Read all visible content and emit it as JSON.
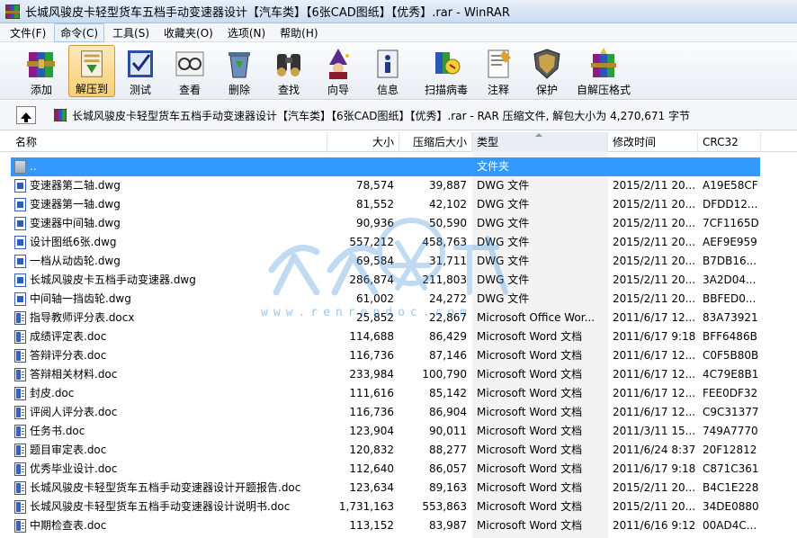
{
  "window": {
    "title": "长城风骏皮卡轻型货车五档手动变速器设计【汽车类】【6张CAD图纸】【优秀】.rar - WinRAR"
  },
  "menu": [
    {
      "label": "文件(F)"
    },
    {
      "label": "命令(C)"
    },
    {
      "label": "工具(S)"
    },
    {
      "label": "收藏夹(O)"
    },
    {
      "label": "选项(N)"
    },
    {
      "label": "帮助(H)"
    }
  ],
  "toolbar": [
    {
      "label": "添加",
      "icon": "add-books-icon"
    },
    {
      "label": "解压到",
      "icon": "extract-to-icon"
    },
    {
      "label": "测试",
      "icon": "test-check-icon"
    },
    {
      "label": "查看",
      "icon": "view-glasses-icon"
    },
    {
      "label": "删除",
      "icon": "delete-recycle-icon"
    },
    {
      "label": "查找",
      "icon": "find-binoculars-icon"
    },
    {
      "label": "向导",
      "icon": "wizard-icon"
    },
    {
      "label": "信息",
      "icon": "info-icon"
    },
    {
      "label": "扫描病毒",
      "icon": "scan-virus-icon"
    },
    {
      "label": "注释",
      "icon": "comment-icon"
    },
    {
      "label": "保护",
      "icon": "protect-shield-icon"
    },
    {
      "label": "自解压格式",
      "icon": "sfx-icon"
    }
  ],
  "pathbar": {
    "text": "长城风骏皮卡轻型货车五档手动变速器设计【汽车类】【6张CAD图纸】【优秀】.rar - RAR 压缩文件, 解包大小为 4,270,671 字节"
  },
  "columns": {
    "name": "名称",
    "size": "大小",
    "packed": "压缩后大小",
    "type": "类型",
    "modified": "修改时间",
    "crc": "CRC32"
  },
  "watermark": {
    "text": "人人文库",
    "url": "www.renrendoc.com"
  },
  "files": [
    {
      "name": "..",
      "size": "",
      "packed": "",
      "type": "文件夹",
      "modified": "",
      "crc": "",
      "kind": "folder",
      "selected": true
    },
    {
      "name": "变速器第二轴.dwg",
      "size": "78,574",
      "packed": "39,887",
      "type": "DWG 文件",
      "modified": "2015/2/11 20...",
      "crc": "A19E58CF",
      "kind": "dwg"
    },
    {
      "name": "变速器第一轴.dwg",
      "size": "81,552",
      "packed": "42,102",
      "type": "DWG 文件",
      "modified": "2015/2/11 20...",
      "crc": "DFDD12...",
      "kind": "dwg"
    },
    {
      "name": "变速器中间轴.dwg",
      "size": "90,936",
      "packed": "50,590",
      "type": "DWG 文件",
      "modified": "2015/2/11 20...",
      "crc": "7CF1165D",
      "kind": "dwg"
    },
    {
      "name": "设计图纸6张.dwg",
      "size": "557,212",
      "packed": "458,763",
      "type": "DWG 文件",
      "modified": "2015/2/11 20...",
      "crc": "AEF9E959",
      "kind": "dwg"
    },
    {
      "name": "一档从动齿轮.dwg",
      "size": "69,584",
      "packed": "31,711",
      "type": "DWG 文件",
      "modified": "2015/2/11 20...",
      "crc": "B7DB16...",
      "kind": "dwg"
    },
    {
      "name": "长城风骏皮卡五档手动变速器.dwg",
      "size": "286,874",
      "packed": "211,803",
      "type": "DWG 文件",
      "modified": "2015/2/11 20...",
      "crc": "3A2D04...",
      "kind": "dwg"
    },
    {
      "name": "中间轴一挡齿轮.dwg",
      "size": "61,002",
      "packed": "24,272",
      "type": "DWG 文件",
      "modified": "2015/2/11 20...",
      "crc": "BBFED0...",
      "kind": "dwg"
    },
    {
      "name": "指导教师评分表.docx",
      "size": "25,852",
      "packed": "22,867",
      "type": "Microsoft Office Wor...",
      "modified": "2011/6/17 12...",
      "crc": "83A73921",
      "kind": "doc"
    },
    {
      "name": "成绩评定表.doc",
      "size": "114,688",
      "packed": "86,429",
      "type": "Microsoft Word 文档",
      "modified": "2011/6/17 9:18",
      "crc": "BFF6486B",
      "kind": "doc"
    },
    {
      "name": "答辩评分表.doc",
      "size": "116,736",
      "packed": "87,146",
      "type": "Microsoft Word 文档",
      "modified": "2011/6/17 12...",
      "crc": "C0F5B80B",
      "kind": "doc"
    },
    {
      "name": "答辩相关材料.doc",
      "size": "233,984",
      "packed": "100,790",
      "type": "Microsoft Word 文档",
      "modified": "2011/6/17 12...",
      "crc": "4C79E8B1",
      "kind": "doc"
    },
    {
      "name": "封皮.doc",
      "size": "111,616",
      "packed": "85,142",
      "type": "Microsoft Word 文档",
      "modified": "2011/6/17 12...",
      "crc": "FEE0DF32",
      "kind": "doc"
    },
    {
      "name": "评阅人评分表.doc",
      "size": "116,736",
      "packed": "86,904",
      "type": "Microsoft Word 文档",
      "modified": "2011/6/17 12...",
      "crc": "C9C31377",
      "kind": "doc"
    },
    {
      "name": "任务书.doc",
      "size": "123,904",
      "packed": "90,011",
      "type": "Microsoft Word 文档",
      "modified": "2011/3/11 15...",
      "crc": "749A7770",
      "kind": "doc"
    },
    {
      "name": "题目审定表.doc",
      "size": "120,832",
      "packed": "88,277",
      "type": "Microsoft Word 文档",
      "modified": "2011/6/24 8:37",
      "crc": "20F12812",
      "kind": "doc"
    },
    {
      "name": "优秀毕业设计.doc",
      "size": "112,640",
      "packed": "86,057",
      "type": "Microsoft Word 文档",
      "modified": "2011/6/17 9:18",
      "crc": "C871C361",
      "kind": "doc"
    },
    {
      "name": "长城风骏皮卡轻型货车五档手动变速器设计开题报告.doc",
      "size": "123,634",
      "packed": "89,163",
      "type": "Microsoft Word 文档",
      "modified": "2015/2/11 20...",
      "crc": "B4C1E228",
      "kind": "doc"
    },
    {
      "name": "长城风骏皮卡轻型货车五档手动变速器设计说明书.doc",
      "size": "1,731,163",
      "packed": "553,863",
      "type": "Microsoft Word 文档",
      "modified": "2015/2/11 20...",
      "crc": "34DE0880",
      "kind": "doc"
    },
    {
      "name": "中期检查表.doc",
      "size": "113,152",
      "packed": "83,987",
      "type": "Microsoft Word 文档",
      "modified": "2011/6/16 9:12",
      "crc": "00AD4C...",
      "kind": "doc"
    }
  ]
}
